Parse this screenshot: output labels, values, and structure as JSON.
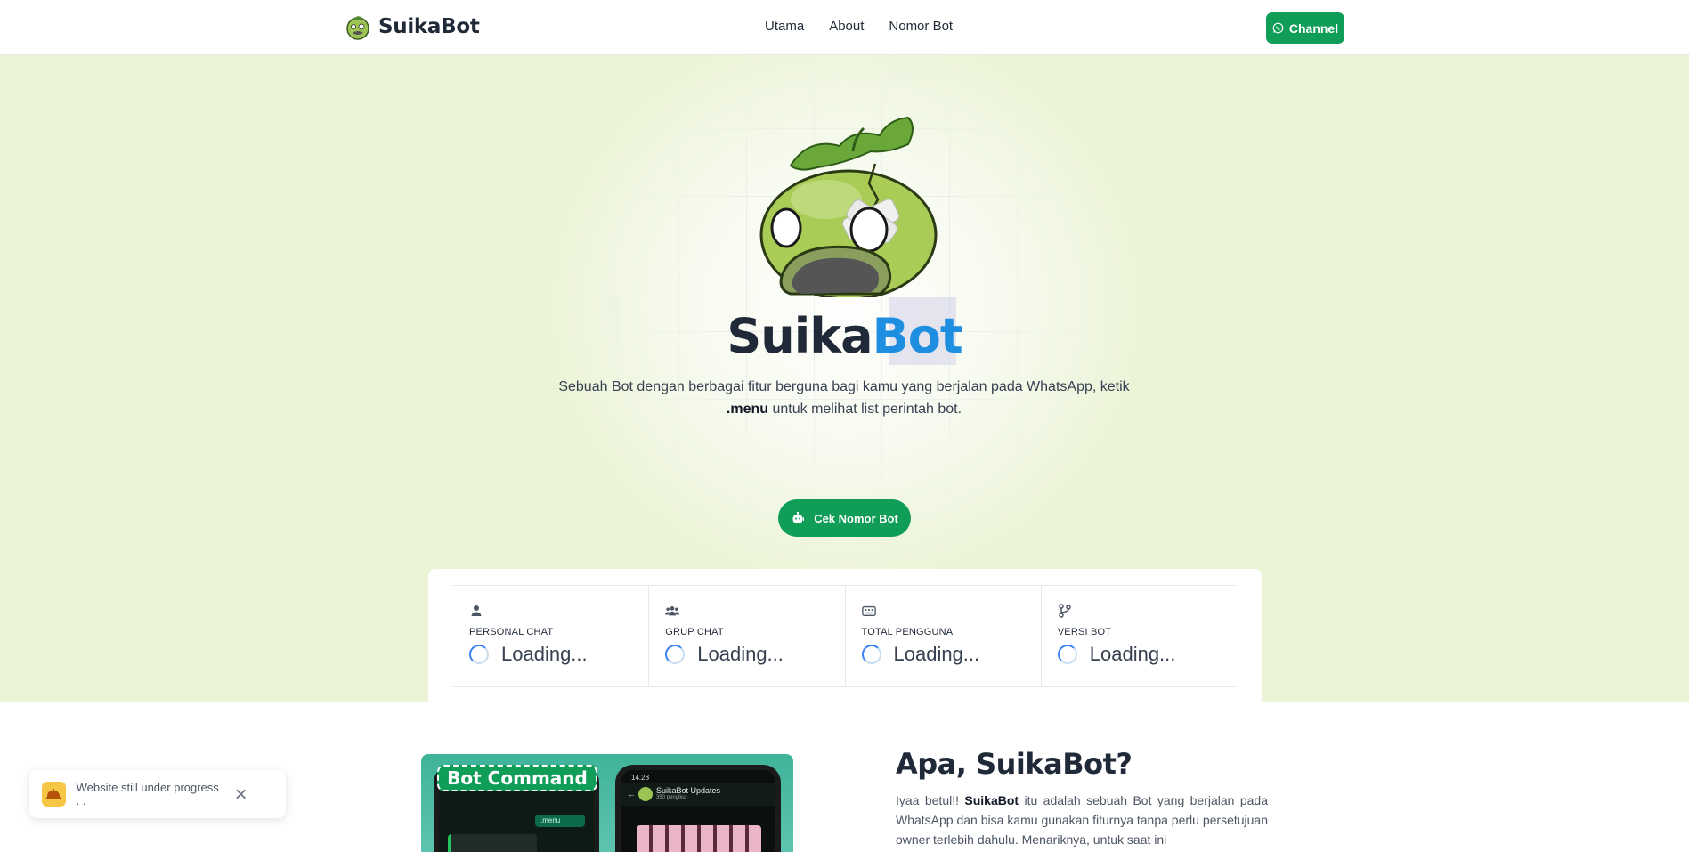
{
  "nav": {
    "brand": "SuikaBot",
    "links": [
      "Utama",
      "About",
      "Nomor Bot"
    ],
    "channel_label": "Channel"
  },
  "hero": {
    "title_part1": "Suika",
    "title_part2": "Bot",
    "desc_line1": "Sebuah Bot dengan berbagai fitur berguna bagi kamu yang berjalan pada WhatsApp, ketik",
    "desc_cmd": ".menu",
    "desc_line2": " untuk melihat list perintah bot.",
    "cta_label": "Cek Nomor Bot"
  },
  "stats": [
    {
      "label": "PERSONAL CHAT",
      "value": "Loading...",
      "icon": "user-icon"
    },
    {
      "label": "GRUP CHAT",
      "value": "Loading...",
      "icon": "users-icon"
    },
    {
      "label": "TOTAL PENGGUNA",
      "value": "Loading...",
      "icon": "keyboard-icon"
    },
    {
      "label": "VERSI BOT",
      "value": "Loading...",
      "icon": "code-branch-icon"
    }
  ],
  "about": {
    "banner": "Bot Command",
    "title": "Apa, SuikaBot?",
    "text_pre": "Iyaa betul!! ",
    "text_brand": "SuikaBot",
    "text_post": " itu adalah sebuah Bot yang berjalan pada WhatsApp dan bisa kamu gunakan fiturnya tanpa perlu persetujuan owner terlebih dahulu. Menariknya, untuk saat ini",
    "phone_channel": "SuikaBot Updates",
    "phone_sub": "350 pengikut",
    "phone_time": "14.28",
    "phone_cmd": ".menu"
  },
  "toast": {
    "text": "Website still under progress . ."
  },
  "colors": {
    "accent_green": "#0f9d58",
    "accent_blue": "#1e8fe0",
    "hero_bg": "#ecf4d8"
  }
}
